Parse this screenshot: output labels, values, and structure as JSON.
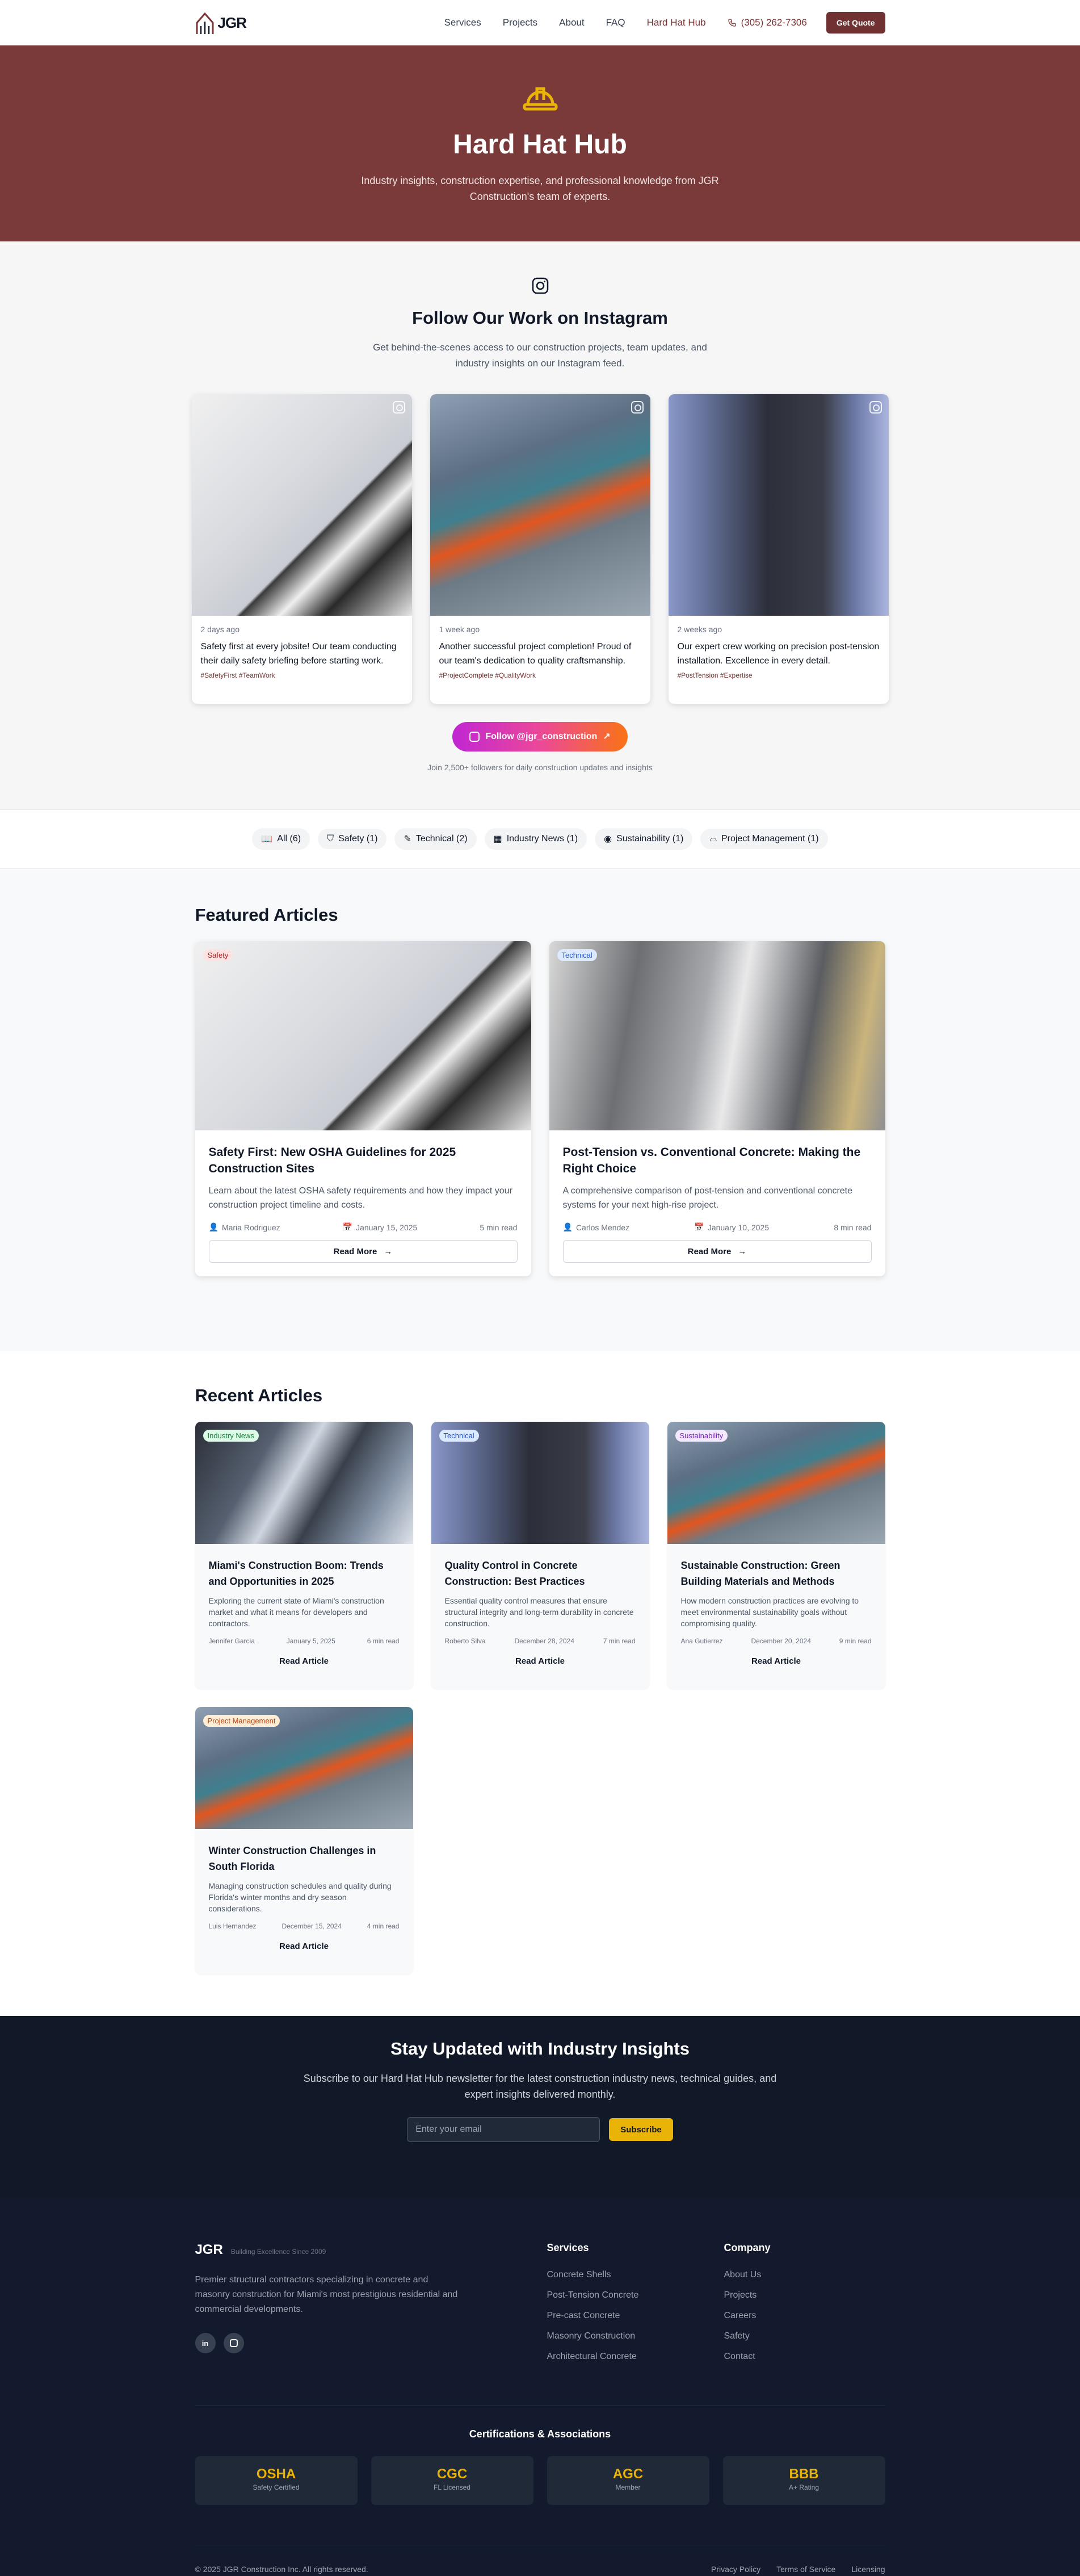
{
  "header": {
    "logo": "JGR",
    "nav": [
      "Services",
      "Projects",
      "About",
      "FAQ",
      "Hard Hat Hub"
    ],
    "phone": "(305) 262-7306",
    "cta": "Get Quote"
  },
  "hero": {
    "title": "Hard Hat Hub",
    "subtitle": "Industry insights, construction expertise, and professional knowledge from JGR Construction's team of experts."
  },
  "instagram": {
    "title": "Follow Our Work on Instagram",
    "subtitle": "Get behind-the-scenes access to our construction projects, team updates, and industry insights on our Instagram feed.",
    "posts": [
      {
        "time": "2 days ago",
        "caption": "Safety first at every jobsite! Our team conducting their daily safety briefing before starting work.",
        "tags": "#SafetyFirst #TeamWork"
      },
      {
        "time": "1 week ago",
        "caption": "Another successful project completion! Proud of our team's dedication to quality craftsmanship.",
        "tags": "#ProjectComplete #QualityWork"
      },
      {
        "time": "2 weeks ago",
        "caption": "Our expert crew working on precision post-tension installation. Excellence in every detail.",
        "tags": "#PostTension #Expertise"
      }
    ],
    "button": "Follow @jgr_construction",
    "followers": "Join 2,500+ followers for daily construction updates and insights"
  },
  "filters": [
    "All (6)",
    "Safety (1)",
    "Technical (2)",
    "Industry News (1)",
    "Sustainability (1)",
    "Project Management (1)"
  ],
  "featured": {
    "title": "Featured Articles",
    "articles": [
      {
        "badge": "Safety",
        "title": "Safety First: New OSHA Guidelines for 2025 Construction Sites",
        "excerpt": "Learn about the latest OSHA safety requirements and how they impact your construction project timeline and costs.",
        "author": "Maria Rodriguez",
        "date": "January 15, 2025",
        "read": "5 min read",
        "button": "Read More"
      },
      {
        "badge": "Technical",
        "title": "Post-Tension vs. Conventional Concrete: Making the Right Choice",
        "excerpt": "A comprehensive comparison of post-tension and conventional concrete systems for your next high-rise project.",
        "author": "Carlos Mendez",
        "date": "January 10, 2025",
        "read": "8 min read",
        "button": "Read More"
      }
    ]
  },
  "recent": {
    "title": "Recent Articles",
    "articles": [
      {
        "badge": "Industry News",
        "title": "Miami's Construction Boom: Trends and Opportunities in 2025",
        "excerpt": "Exploring the current state of Miami's construction market and what it means for developers and contractors.",
        "author": "Jennifer Garcia",
        "date": "January 5, 2025",
        "read": "6 min read",
        "button": "Read Article"
      },
      {
        "badge": "Technical",
        "title": "Quality Control in Concrete Construction: Best Practices",
        "excerpt": "Essential quality control measures that ensure structural integrity and long-term durability in concrete construction.",
        "author": "Roberto Silva",
        "date": "December 28, 2024",
        "read": "7 min read",
        "button": "Read Article"
      },
      {
        "badge": "Sustainability",
        "title": "Sustainable Construction: Green Building Materials and Methods",
        "excerpt": "How modern construction practices are evolving to meet environmental sustainability goals without compromising quality.",
        "author": "Ana Gutierrez",
        "date": "December 20, 2024",
        "read": "9 min read",
        "button": "Read Article"
      },
      {
        "badge": "Project Management",
        "title": "Winter Construction Challenges in South Florida",
        "excerpt": "Managing construction schedules and quality during Florida's winter months and dry season considerations.",
        "author": "Luis Hernandez",
        "date": "December 15, 2024",
        "read": "4 min read",
        "button": "Read Article"
      }
    ]
  },
  "newsletter": {
    "title": "Stay Updated with Industry Insights",
    "subtitle": "Subscribe to our Hard Hat Hub newsletter for the latest construction industry news, technical guides, and expert insights delivered monthly.",
    "placeholder": "Enter your email",
    "button": "Subscribe"
  },
  "footer": {
    "brand": "JGR",
    "tagline": "Building Excellence Since 2009",
    "about": "Premier structural contractors specializing in concrete and masonry construction for Miami's most prestigious residential and commercial developments.",
    "social": [
      "in"
    ],
    "services_title": "Services",
    "services": [
      "Concrete Shells",
      "Post-Tension Concrete",
      "Pre-cast Concrete",
      "Masonry Construction",
      "Architectural Concrete"
    ],
    "company_title": "Company",
    "company": [
      "About Us",
      "Projects",
      "Careers",
      "Safety",
      "Contact"
    ],
    "certs_title": "Certifications & Associations",
    "certs": [
      {
        "name": "OSHA",
        "desc": "Safety Certified"
      },
      {
        "name": "CGC",
        "desc": "FL Licensed"
      },
      {
        "name": "AGC",
        "desc": "Member"
      },
      {
        "name": "BBB",
        "desc": "A+ Rating"
      }
    ],
    "copyright": "© 2025 JGR Construction Inc. All rights reserved.",
    "legal": [
      "Privacy Policy",
      "Terms of Service",
      "Licensing"
    ]
  },
  "colors": {
    "brand": "#7a3a3a",
    "accent": "#eab308",
    "dark": "#111827"
  }
}
